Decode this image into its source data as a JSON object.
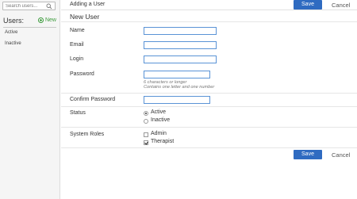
{
  "sidebar": {
    "search_placeholder": "Search users...",
    "users_title": "Users:",
    "new_label": "New",
    "items": [
      {
        "label": "Active"
      },
      {
        "label": "Inactive"
      }
    ]
  },
  "header": {
    "breadcrumb": "Adding a User",
    "save_label": "Save",
    "cancel_label": "Cancel"
  },
  "form": {
    "title": "New User",
    "name_label": "Name",
    "name_value": "",
    "email_label": "Email",
    "email_value": "",
    "login_label": "Login",
    "login_value": "",
    "password_label": "Password",
    "password_value": "",
    "password_hint_1": "6 characters or longer",
    "password_hint_2": "Contains one letter and one number",
    "confirm_label": "Confirm Password",
    "confirm_value": "",
    "status_label": "Status",
    "status_options": [
      {
        "label": "Active",
        "selected": true
      },
      {
        "label": "Inactive",
        "selected": false
      }
    ],
    "roles_label": "System Roles",
    "roles_options": [
      {
        "label": "Admin",
        "checked": false
      },
      {
        "label": "Therapist",
        "checked": true
      }
    ]
  },
  "footer": {
    "save_label": "Save",
    "cancel_label": "Cancel"
  },
  "colors": {
    "primary": "#2f6bc1",
    "new_green": "#3c9b3c",
    "field_border": "#5a93d6"
  }
}
